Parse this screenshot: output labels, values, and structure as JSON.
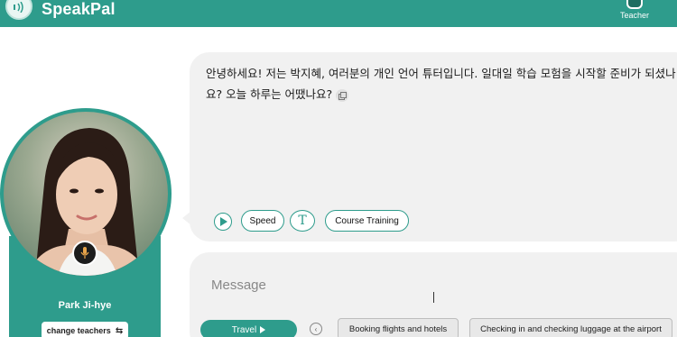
{
  "app": {
    "title": "SpeakPal",
    "brand_color": "#2e9c8c"
  },
  "header": {
    "teacher_label": "Teacher",
    "logo_icon": "sound-wave-icon",
    "teacher_icon": "teacher-icon"
  },
  "teacher": {
    "name": "Park Ji-hye",
    "change_label": "change teachers",
    "change_icon": "swap-arrows-icon",
    "mic_icon": "microphone-icon"
  },
  "chat": {
    "message": "안녕하세요! 저는 박지혜, 여러분의 개인 언어 튜터입니다. 일대일 학습 모험을 시작할 준비가 되셨나요? 오늘 하루는 어땠나요?",
    "copy_icon": "copy-icon",
    "controls": {
      "play_icon": "play-icon",
      "speed_label": "Speed",
      "translate_glyph": "T",
      "course_label": "Course Training"
    }
  },
  "composer": {
    "placeholder": "Message",
    "topic_label": "Travel",
    "suggestions": [
      "Booking flights and hotels",
      "Checking in and checking luggage at the airport"
    ]
  }
}
